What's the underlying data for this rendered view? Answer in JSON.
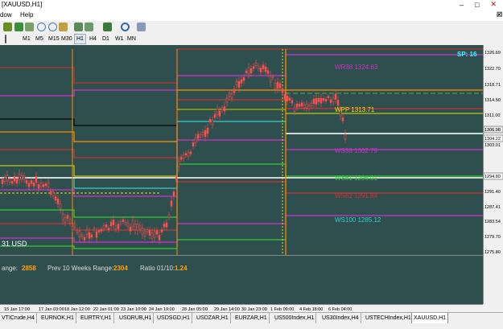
{
  "window": {
    "title": "[XAUUSD,H1]"
  },
  "menu": {
    "window_label": "dow",
    "help_label": "Help"
  },
  "timeframes": [
    "M1",
    "M5",
    "M15",
    "M30",
    "H1",
    "H4",
    "D1",
    "W1",
    "MN"
  ],
  "active_timeframe": "H1",
  "chart": {
    "spread_label": "SP: 16",
    "prices": [
      "1326.69",
      "1322.70",
      "1318.71",
      "1314.50",
      "1311.00",
      "1306.98",
      "1304.22",
      "1303.01",
      "1294.80",
      "1291.40",
      "1287.41",
      "1283.54",
      "1279.70",
      "1275.80"
    ],
    "levels": {
      "wr38": "WR38 1324.63",
      "wpp": "WPP 1313.71",
      "ws38": "WS38 1302.79",
      "ws61": "WS61 1296.01",
      "ws62": "WS62 1291.84",
      "ws100": "WS100 1285.12"
    },
    "left_label": "31 USD",
    "stats": {
      "range_label": "ange:",
      "range_value": "2858",
      "prev_label": "Prev 10 Weeks Range:",
      "prev_value": "2304",
      "ratio_label": "Ratio 01/10:",
      "ratio_value": "1.24"
    },
    "time_labels": [
      "15 Jan 17:00",
      "17 Jan 03:00",
      "18 Jan 12:00",
      "22 Jan 01:00",
      "23 Jan 10:00",
      "24 Jan 19:00",
      "28 Jan 05:00",
      "29 Jan 14:00",
      "30 Jan 23:00",
      "1 Feb 09:00",
      "4 Feb 18:00",
      "6 Feb 04:00"
    ]
  },
  "tabs": [
    "VTICrude,H4",
    "EURNOK,H1",
    "EURTRY,H1",
    "USDRUB,H1",
    "USDSGD,H1",
    "USDZAR,H1",
    "EURZAR,H1",
    "US500Index,H1",
    "US30Index,H4",
    "USTECHIndex,H1",
    "XAUUSD,H1"
  ],
  "active_tab": "XAUUSD,H1",
  "colors": {
    "chart_bg": "#2f4f4f",
    "up": "#ff4d4d",
    "down": "#ff8080",
    "magenta": "#cc33cc",
    "cyan": "#33cccc",
    "yellow": "#e6e600",
    "green": "#33cc33",
    "orange": "#ff8c00"
  }
}
